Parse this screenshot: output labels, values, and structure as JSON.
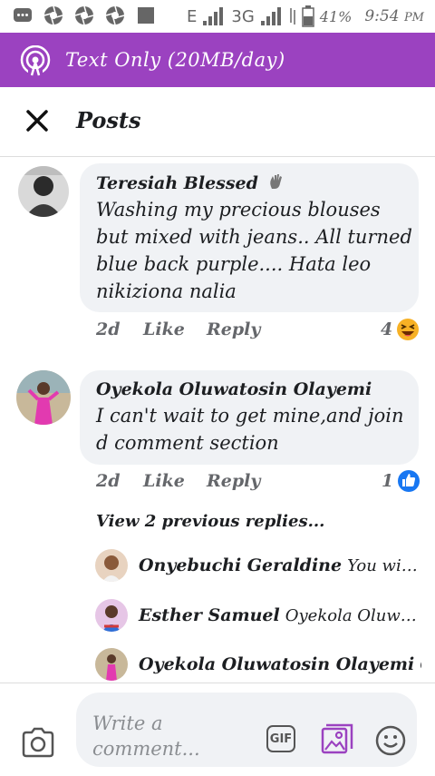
{
  "status_bar": {
    "battery": "41%",
    "time": "9:54",
    "ampm": "PM",
    "network_e": "E",
    "network_3g": "3G"
  },
  "banner": {
    "text": "Text Only (20MB/day)"
  },
  "header": {
    "title": "Posts"
  },
  "comments": [
    {
      "name": "Teresiah Blessed",
      "text_lines": [
        "Washing my precious blouses",
        "but mixed with jeans.. All turned",
        "blue back  purple.... Hata leo",
        "nikiziona nalia"
      ],
      "time": "2d",
      "like": "Like",
      "reply": "Reply",
      "reactions": "4"
    },
    {
      "name": "Oyekola Oluwatosin Olayemi",
      "text_lines": [
        "I can't wait to get mine,and join",
        "d comment section"
      ],
      "time": "2d",
      "like": "Like",
      "reply": "Reply",
      "reactions": "1"
    }
  ],
  "view_previous": "View 2 previous replies...",
  "replies": [
    {
      "name": "Onyebuchi Geraldine",
      "text": "You will e..."
    },
    {
      "name": "Esther Samuel",
      "text": "Oyekola Oluwato..."
    },
    {
      "name": "Oyekola Oluwatosin Olayemi",
      "text": "O..."
    }
  ],
  "composer": {
    "placeholder_line1": "Write a",
    "placeholder_line2": "comment...",
    "gif": "GIF"
  },
  "colors": {
    "banner": "#9b42c0",
    "bubble": "#f0f2f5",
    "like_blue": "#1877f2",
    "meta_gray": "#65676b"
  }
}
